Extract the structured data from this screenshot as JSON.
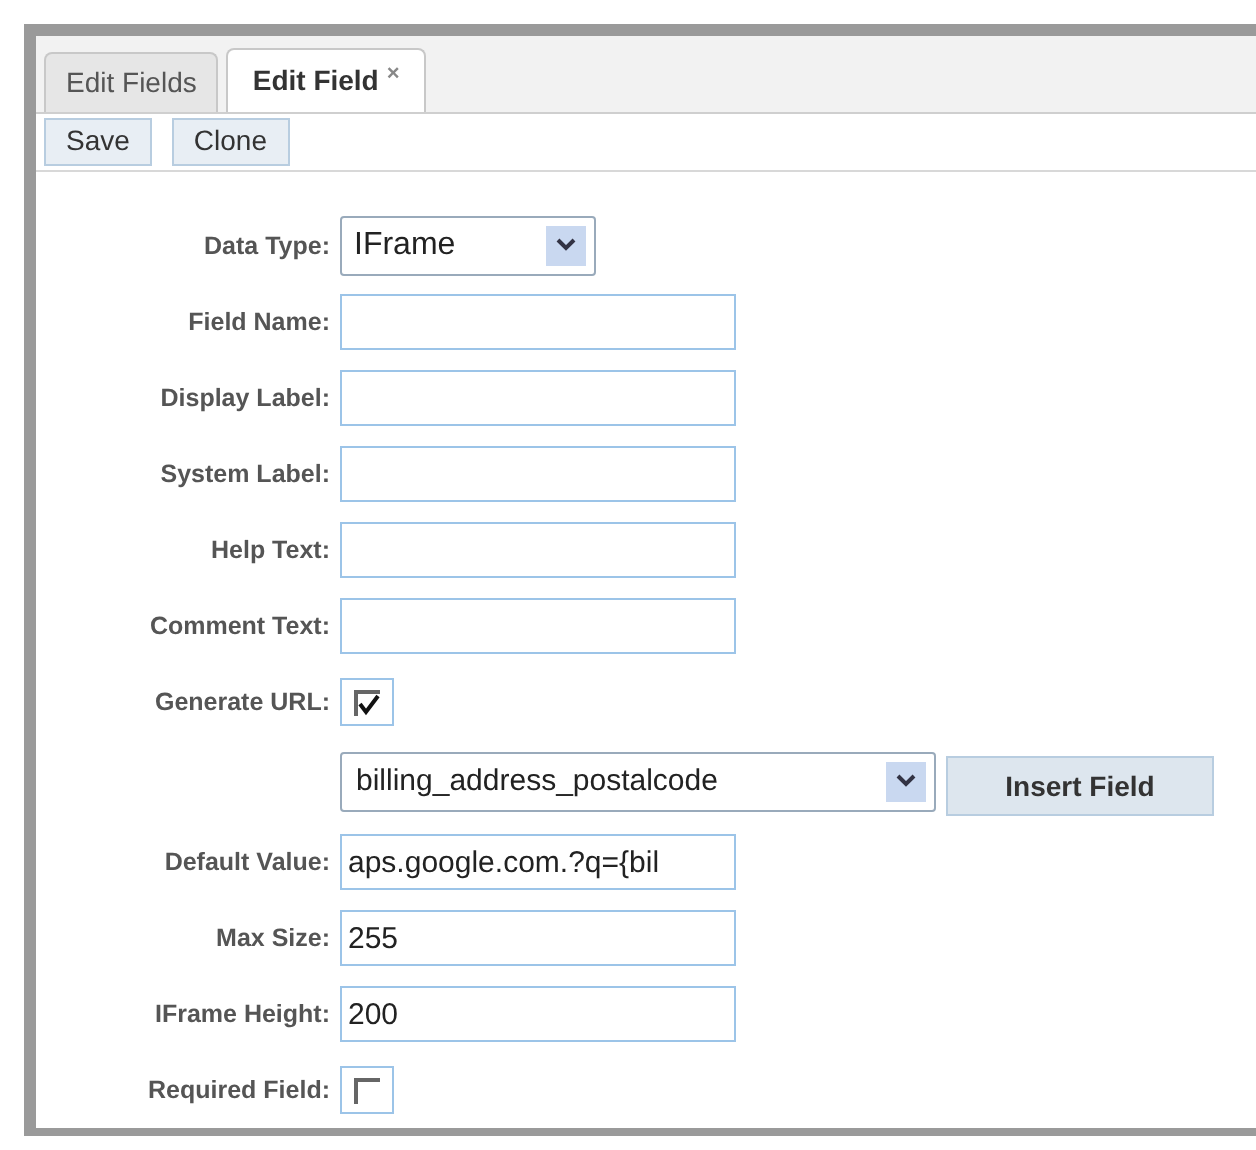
{
  "tabs": [
    {
      "label": "Edit Fields",
      "selected": false
    },
    {
      "label": "Edit Field",
      "selected": true,
      "close_glyph": "×"
    }
  ],
  "toolbar": [
    "Save",
    "Clone"
  ],
  "form": [
    {
      "kind": "select",
      "label": "Data Type:",
      "value": "IFrame"
    },
    {
      "kind": "text",
      "label": "Field Name:"
    },
    {
      "kind": "text",
      "label": "Display Label:"
    },
    {
      "kind": "text",
      "label": "System Label:"
    },
    {
      "kind": "text",
      "label": "Help Text:"
    },
    {
      "kind": "text",
      "label": "Comment Text:"
    },
    {
      "kind": "checkbox",
      "label": "Generate URL:",
      "checked": true
    },
    {
      "kind": "insert",
      "value": "billing_address_postalcode",
      "button": "Insert Field"
    },
    {
      "kind": "text",
      "label": "Default Value:",
      "value": "aps.google.com.?q={bil"
    },
    {
      "kind": "text",
      "label": "Max Size:",
      "value": "255"
    },
    {
      "kind": "text",
      "label": "IFrame Height:",
      "value": "200"
    },
    {
      "kind": "checkbox",
      "label": "Required Field:",
      "checked": false
    }
  ]
}
